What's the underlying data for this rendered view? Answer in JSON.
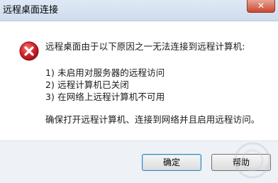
{
  "window": {
    "title": "远程桌面连接"
  },
  "dialog": {
    "icon": "error-icon",
    "message": "远程桌面由于以下原因之一无法连接到远程计算机:",
    "reasons": [
      "1) 未启用对服务器的远程访问",
      "2) 远程计算机已关闭",
      "3) 在网络上远程计算机不可用"
    ],
    "advice": "确保打开远程计算机、连接到网络并且启用远程访问。"
  },
  "buttons": {
    "ok_label": "确定",
    "help_label": "帮助"
  },
  "colors": {
    "error_red": "#c8202a",
    "footer_bg": "#eef1f5",
    "titlebar_bg": "#dfe9f5"
  }
}
